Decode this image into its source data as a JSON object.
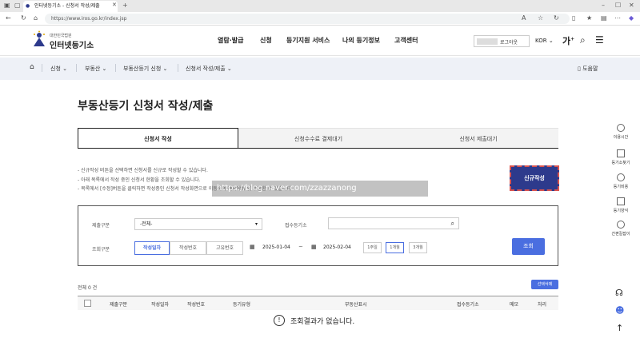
{
  "browser": {
    "tab_title": "인터넷등기소 - 신청서 작성/제출",
    "url": "https://www.iros.go.kr/index.jsp"
  },
  "header": {
    "logo_small": "대한민국법원",
    "logo_title": "인터넷등기소",
    "nav": [
      "열람·발급",
      "신청",
      "등기지원 서비스",
      "나의 등기정보",
      "고객센터"
    ],
    "logout_label": "로그아웃",
    "lang": "KOR",
    "font_size_label": "가"
  },
  "breadcrumb": {
    "items": [
      "신청",
      "부동산",
      "부동산등기 신청",
      "신청서 작성/제출"
    ],
    "help": "도움말"
  },
  "page": {
    "title": "부동산등기 신청서 작성/제출",
    "tabs": [
      "신청서 작성",
      "신청수수료 결제대기",
      "신청서 제출대기"
    ],
    "notes": [
      "- 신규작성 버튼을 선택하면 신청서를 신규로 작성할 수 있습니다.",
      "- 아래 목록에서 작성 중인 신청서 현황을 조회할 수 있습니다.",
      "- 목록에서 [수정]버튼을 클릭하면 작성중인 신청서 작성화면으로 이동하여 계속작성 및 수정할 수 있습니다."
    ],
    "new_button": "신규작성",
    "watermark": "https://blog.naver.com/zzazzanong"
  },
  "search": {
    "type_label": "제출구분",
    "type_value": "-전체-",
    "office_label": "접수등기소",
    "office_placeholder": "",
    "period_label": "조회구분",
    "period_tabs": [
      "작성일자",
      "작성번호",
      "고유번호"
    ],
    "date_from": "2025-01-04",
    "date_to": "2025-02-04",
    "tilde": "~",
    "ranges": [
      "1주일",
      "1개월",
      "3개월"
    ],
    "search_button": "조회"
  },
  "results": {
    "count": "전체 0 건",
    "delete_button": "선택삭제",
    "columns": [
      "제출구분",
      "작성일자",
      "작성번호",
      "등기유형",
      "부동산표시",
      "접수등기소",
      "메모",
      "처리"
    ],
    "empty_message": "조회결과가 없습니다."
  },
  "sidebar": {
    "items": [
      "이용시간",
      "등기소찾기",
      "등기비용",
      "등기양식",
      "간편길잡이"
    ]
  },
  "colors": {
    "primary": "#2d3a8c",
    "accent_blue": "#4a6ee0",
    "crumb_bg": "#eef1f7"
  }
}
